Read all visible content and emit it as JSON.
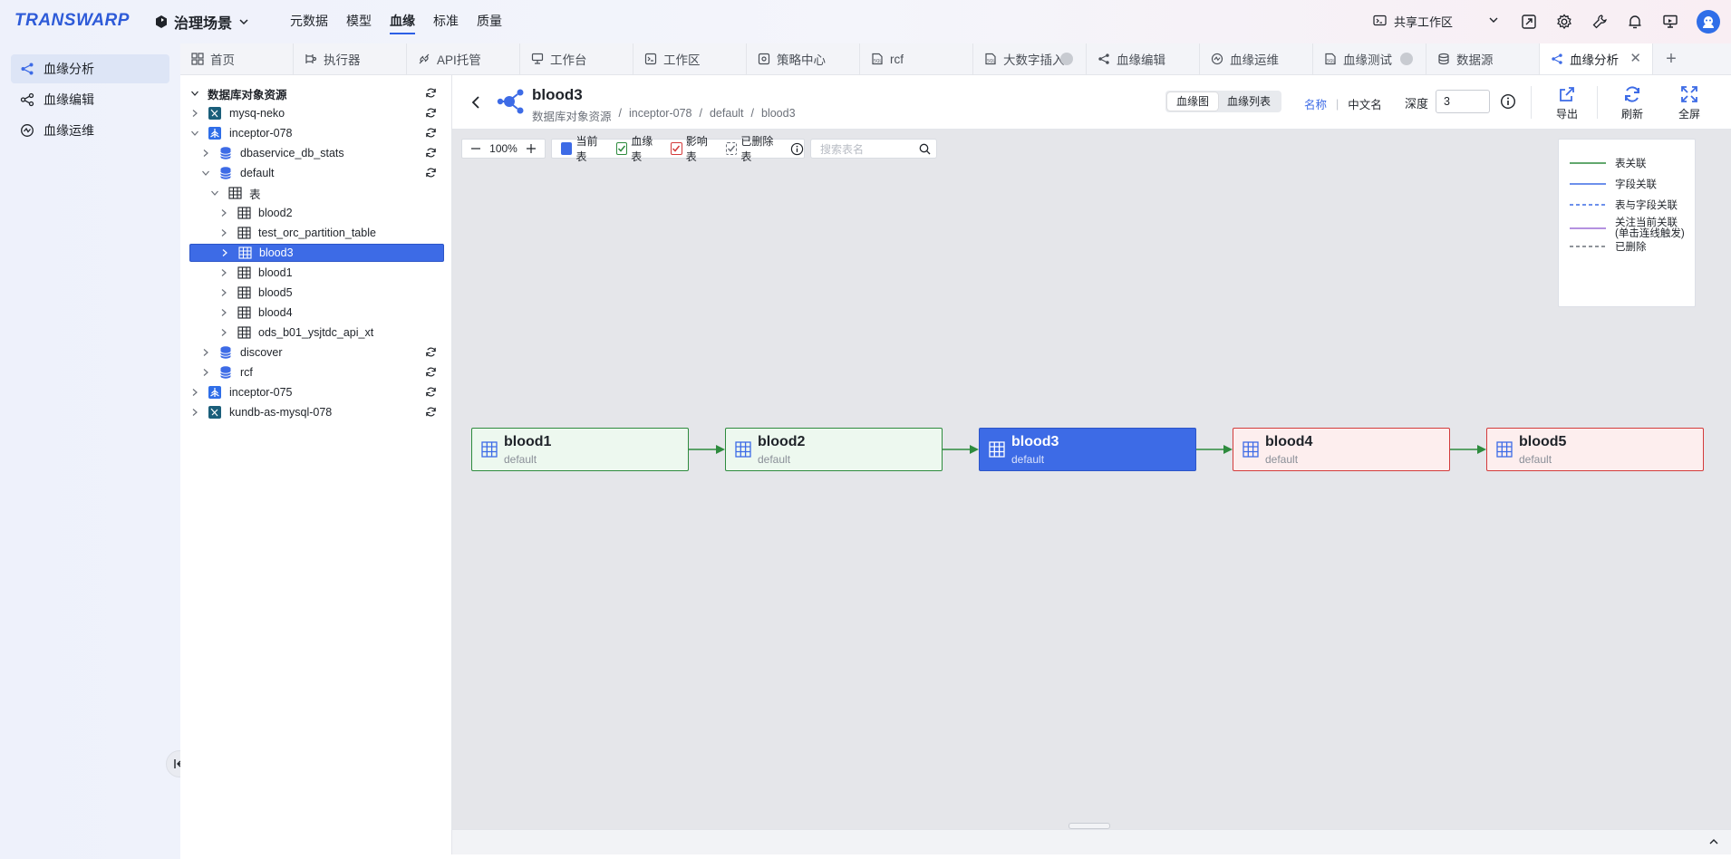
{
  "brand": {
    "logo_text": "TRANSWARP",
    "accent": "#2c5fe6"
  },
  "scene": {
    "label": "治理场景"
  },
  "topnav": [
    {
      "label": "元数据",
      "active": false
    },
    {
      "label": "模型",
      "active": false
    },
    {
      "label": "血缘",
      "active": true
    },
    {
      "label": "标准",
      "active": false
    },
    {
      "label": "质量",
      "active": false
    }
  ],
  "workspace": {
    "label": "共享工作区"
  },
  "leftnav": [
    {
      "label": "血缘分析",
      "icon": "lineage-icon",
      "active": true
    },
    {
      "label": "血缘编辑",
      "icon": "lineage-edit-icon",
      "active": false
    },
    {
      "label": "血缘运维",
      "icon": "lineage-ops-icon",
      "active": false
    }
  ],
  "tabs": [
    {
      "label": "首页",
      "icon": "home-icon"
    },
    {
      "label": "执行器",
      "icon": "executor-icon"
    },
    {
      "label": "API托管",
      "icon": "api-icon"
    },
    {
      "label": "工作台",
      "icon": "workbench-icon"
    },
    {
      "label": "工作区",
      "icon": "workspace-icon"
    },
    {
      "label": "策略中心",
      "icon": "policy-icon"
    },
    {
      "label": "rcf",
      "icon": "sql-icon"
    },
    {
      "label": "大数字插入",
      "icon": "sql-icon",
      "dot": true
    },
    {
      "label": "血缘编辑",
      "icon": "lineage-icon"
    },
    {
      "label": "血缘运维",
      "icon": "lineage-ops-icon"
    },
    {
      "label": "血缘测试",
      "icon": "sql-icon",
      "dot": true
    },
    {
      "label": "数据源",
      "icon": "datasource-icon"
    },
    {
      "label": "血缘分析",
      "icon": "lineage-icon",
      "active": true,
      "closable": true
    }
  ],
  "tree": {
    "header": "数据库对象资源",
    "rows": [
      {
        "label": "mysq-neko",
        "level": 1,
        "type": "mysql",
        "expanded": false,
        "refresh": true
      },
      {
        "label": "inceptor-078",
        "level": 1,
        "type": "inceptor",
        "expanded": true,
        "refresh": true
      },
      {
        "label": "dbaservice_db_stats",
        "level": 2,
        "type": "db",
        "expanded": false,
        "refresh": true
      },
      {
        "label": "default",
        "level": 2,
        "type": "db",
        "expanded": true,
        "refresh": true
      },
      {
        "label": "表",
        "level": 3,
        "type": "table",
        "expanded": true,
        "refresh": false
      },
      {
        "label": "blood2",
        "level": 4,
        "type": "table",
        "expanded": false,
        "refresh": false
      },
      {
        "label": "test_orc_partition_table",
        "level": 4,
        "type": "table",
        "expanded": false,
        "refresh": false
      },
      {
        "label": "blood3",
        "level": 4,
        "type": "table",
        "expanded": false,
        "refresh": false,
        "selected": true
      },
      {
        "label": "blood1",
        "level": 4,
        "type": "table",
        "expanded": false,
        "refresh": false
      },
      {
        "label": "blood5",
        "level": 4,
        "type": "table",
        "expanded": false,
        "refresh": false
      },
      {
        "label": "blood4",
        "level": 4,
        "type": "table",
        "expanded": false,
        "refresh": false
      },
      {
        "label": "ods_b01_ysjtdc_api_xt",
        "level": 4,
        "type": "table",
        "expanded": false,
        "refresh": false
      },
      {
        "label": "discover",
        "level": 2,
        "type": "db",
        "expanded": false,
        "refresh": true
      },
      {
        "label": "rcf",
        "level": 2,
        "type": "db",
        "expanded": false,
        "refresh": true
      },
      {
        "label": "inceptor-075",
        "level": 1,
        "type": "inceptor",
        "expanded": false,
        "refresh": true
      },
      {
        "label": "kundb-as-mysql-078",
        "level": 1,
        "type": "mysql",
        "expanded": false,
        "refresh": true
      }
    ]
  },
  "header": {
    "title": "blood3",
    "breadcrumb": [
      "数据库对象资源",
      "inceptor-078",
      "default",
      "blood3"
    ],
    "view_graph": "血缘图",
    "view_list": "血缘列表",
    "name_mode": "名称",
    "cn_mode": "中文名",
    "depth_label": "深度",
    "depth_value": "3",
    "export": "导出",
    "refresh": "刷新",
    "fullscreen": "全屏"
  },
  "toolbar": {
    "zoom": "100%",
    "legend_current": "当前表",
    "legend_lineage": "血缘表",
    "legend_impact": "影响表",
    "legend_deleted": "已删除表",
    "search_placeholder": "搜索表名"
  },
  "edge_legend": [
    {
      "label": "表关联",
      "color": "#2e8b3e",
      "style": "solid"
    },
    {
      "label": "字段关联",
      "color": "#3d6be6",
      "style": "solid"
    },
    {
      "label": "表与字段关联",
      "color": "#3d6be6",
      "style": "dashed"
    },
    {
      "label": "关注当前关联",
      "label2": "(单击连线触发)",
      "color": "#9b6dd6",
      "style": "solid"
    },
    {
      "label": "已删除",
      "color": "#6b7079",
      "style": "dashed"
    }
  ],
  "nodes": [
    {
      "name": "blood1",
      "schema": "default",
      "kind": "lineage"
    },
    {
      "name": "blood2",
      "schema": "default",
      "kind": "lineage"
    },
    {
      "name": "blood3",
      "schema": "default",
      "kind": "current"
    },
    {
      "name": "blood4",
      "schema": "default",
      "kind": "impact"
    },
    {
      "name": "blood5",
      "schema": "default",
      "kind": "impact"
    }
  ],
  "colors": {
    "current": "#3d6be6",
    "lineage": "#2e8b3e",
    "impact": "#d33b3b",
    "edge": "#2e8b3e"
  }
}
